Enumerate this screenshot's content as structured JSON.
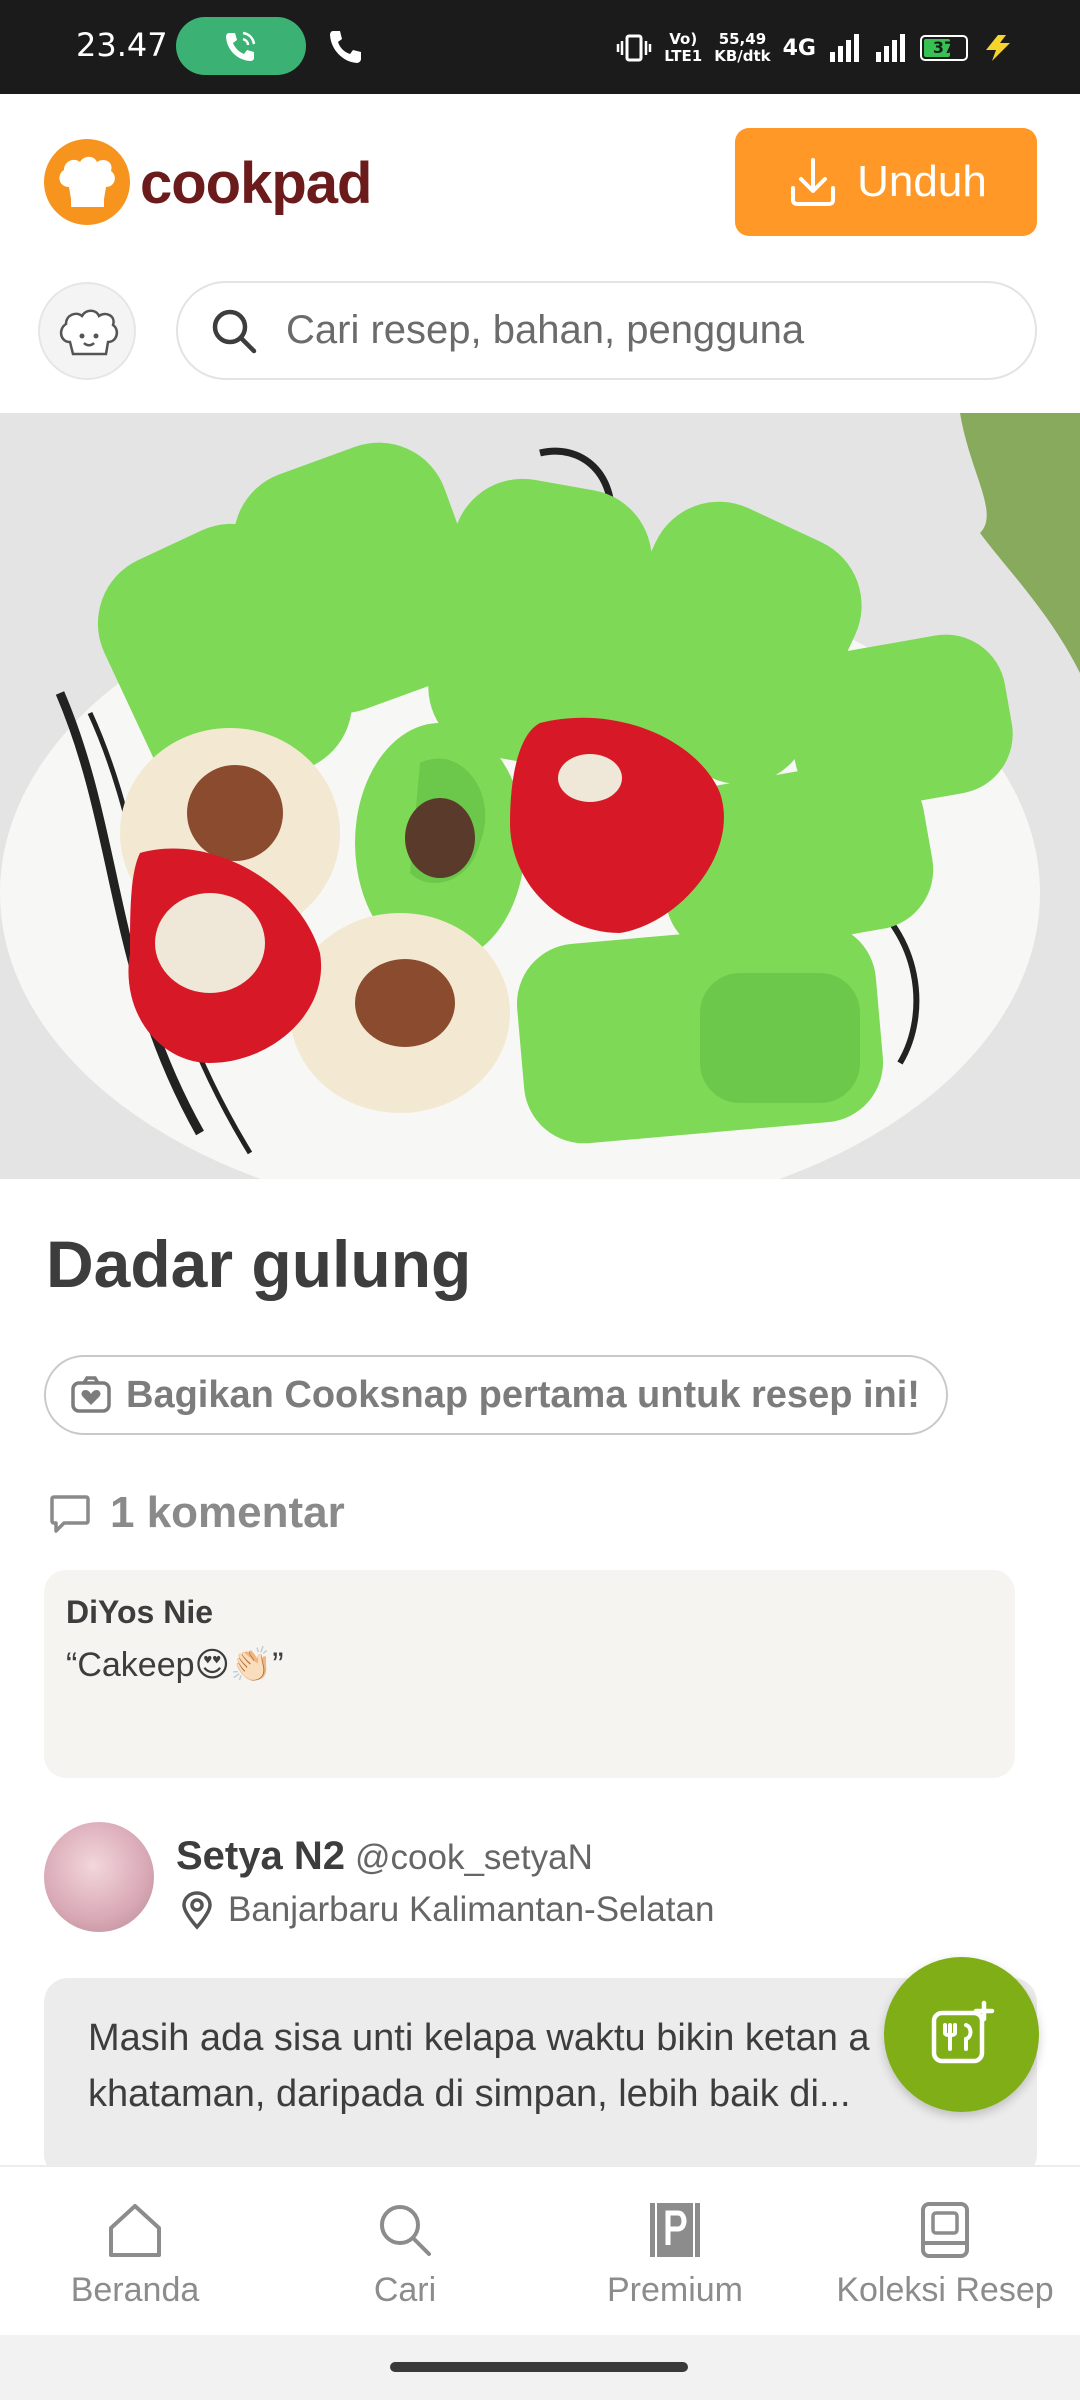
{
  "status_bar": {
    "time": "23.47",
    "volte_top": "Vo)",
    "volte_bottom": "LTE1",
    "speed_top": "55,49",
    "speed_bottom": "KB/dtk",
    "network": "4G",
    "battery": "37"
  },
  "header": {
    "logo_text": "cookpad",
    "download_label": "Unduh",
    "search_placeholder": "Cari resep, bahan, pengguna"
  },
  "recipe": {
    "title": "Dadar gulung",
    "cooksnap_label": "Bagikan Cooksnap pertama untuk resep ini!",
    "comments_count_label": "1 komentar"
  },
  "comment": {
    "author": "DiYos Nie",
    "text": "“Cakeep😍👏🏻”"
  },
  "author": {
    "name": "Setya N2",
    "handle": "@cook_setyaN",
    "location": "Banjarbaru Kalimantan-Selatan"
  },
  "story": {
    "text": "Masih ada sisa unti kelapa waktu bikin ketan a khataman, daripada di simpan, lebih baik di..."
  },
  "bottom_nav": {
    "items": [
      {
        "label": "Beranda",
        "icon": "home-icon"
      },
      {
        "label": "Cari",
        "icon": "search-icon"
      },
      {
        "label": "Premium",
        "icon": "premium-icon"
      },
      {
        "label": "Koleksi Resep",
        "icon": "collection-icon"
      }
    ]
  },
  "colors": {
    "brand_orange": "#ff9826",
    "fab_green": "#7fae17",
    "status_bar": "#1b1b1b"
  }
}
